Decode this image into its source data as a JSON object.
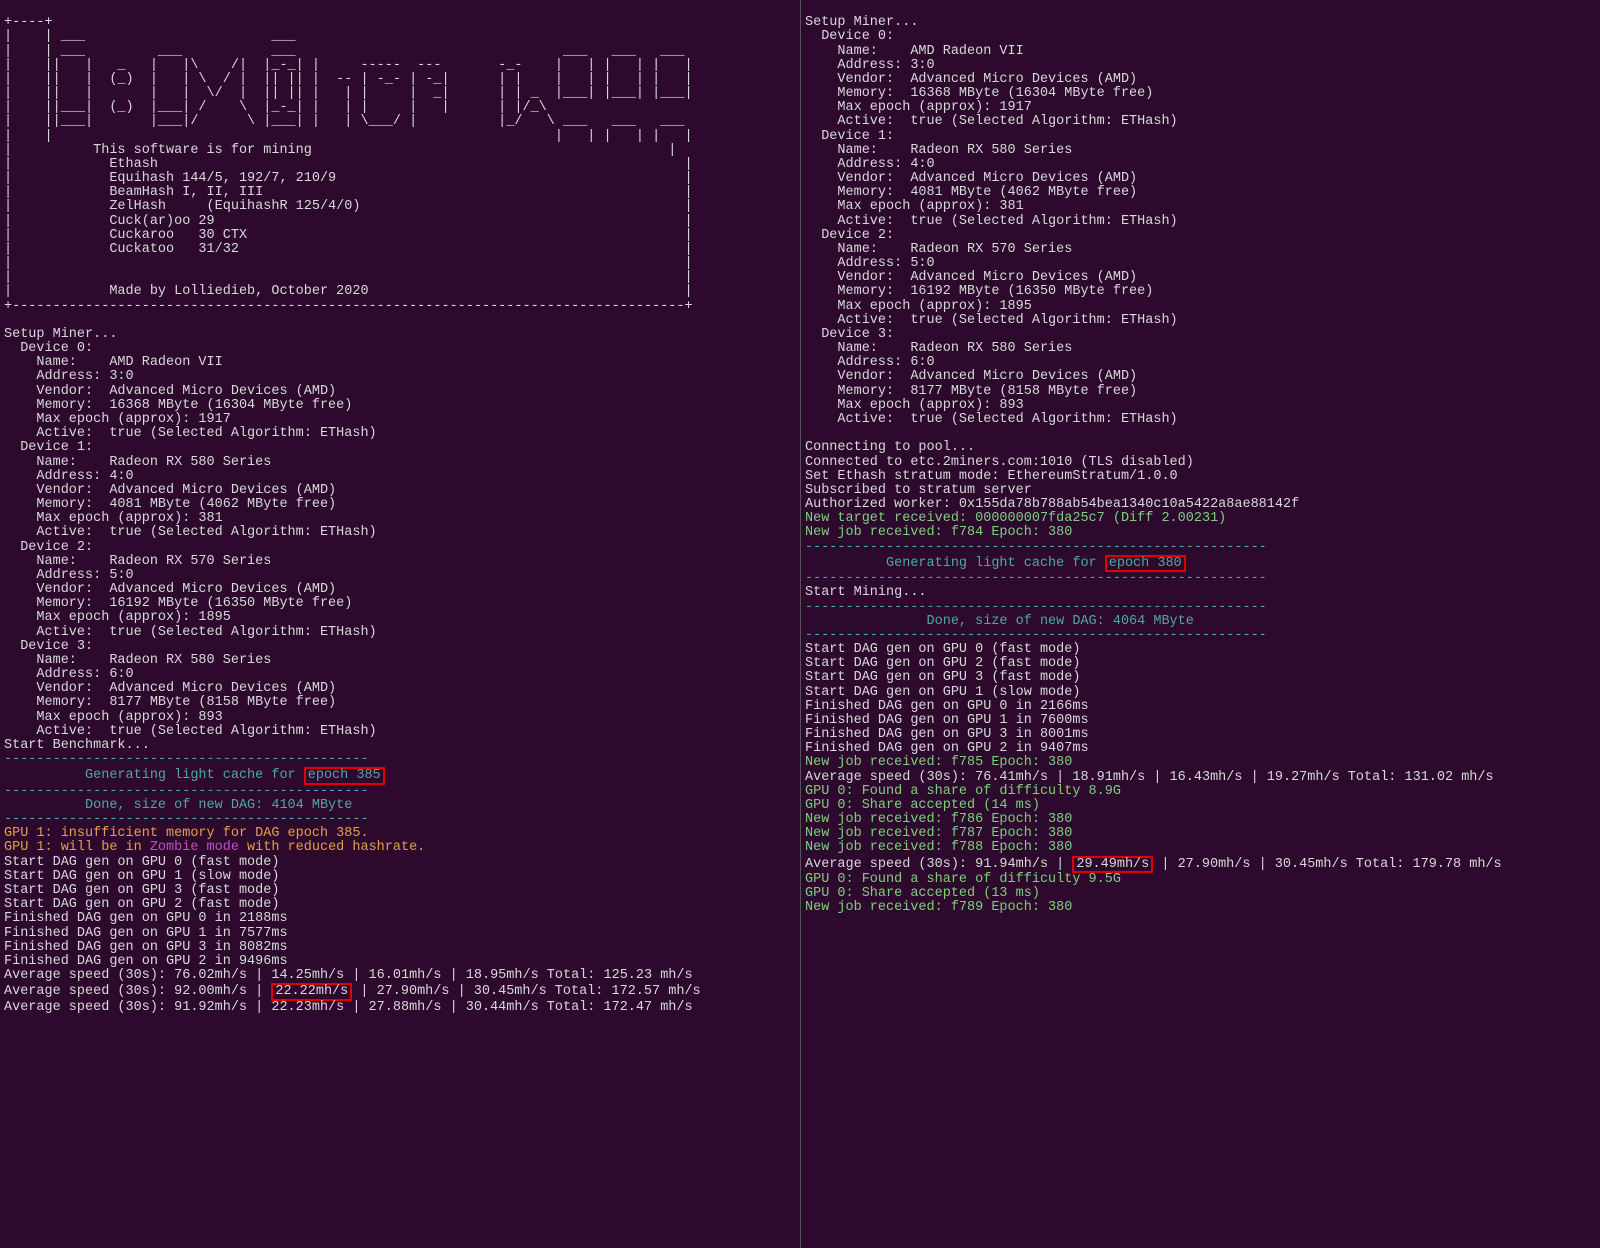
{
  "ascii_art": {
    "l1": "+----+",
    "l2": "|    | ___                       ___",
    "l3": "|    | ___         ___           ___                                 ___   ___   ___",
    "l4": "|    ||   |   _   |   |\\    /|  |_-_| |     -----  ---       -_-    |   | |   | |   |",
    "l5": "|    ||   |  (_)  |   | \\  / |  || || |  -- | -_- | -_|      | |    |   | |   | |   |",
    "l6": "|    ||   |       |   |  \\/  |  || || |   | |     |  _|      | | _  |___| |___| |___|",
    "l7": "|    ||___|  (_)  |___| /    \\  |_-_| |   | |     |   |      | |/_\\",
    "l8": "|    ||___|       |___|/      \\ |___| |   | \\___/ |          |_/   \\ ___   ___   ___",
    "l9": "|    |                                                              |   | |   | |   |",
    "l10": "|          This software is for mining                                            |",
    "l11": "|            Ethash                                                                 |",
    "l12": "|            Equihash 144/5, 192/7, 210/9                                           |",
    "l13": "|            BeamHash I, II, III                                                    |",
    "l14": "|            ZelHash     (EquihashR 125/4/0)                                        |",
    "l15": "|            Cuck(ar)oo 29                                                          |",
    "l16": "|            Cuckaroo   30 CTX                                                      |",
    "l17": "|            Cuckatoo   31/32                                                       |",
    "l18": "|                                                                                   |",
    "l19": "|                                                                                   |",
    "l20": "|            Made by Lolliedieb, October 2020                                       |",
    "l21": "+-----------------------------------------------------------------------------------+"
  },
  "setup": {
    "title": "Setup Miner...",
    "dev0": {
      "hdr": "  Device 0:",
      "name": "    Name:    AMD Radeon VII",
      "addr": "    Address: 3:0",
      "vendor": "    Vendor:  Advanced Micro Devices (AMD)",
      "mem": "    Memory:  16368 MByte (16304 MByte free)",
      "maxep": "    Max epoch (approx): 1917",
      "active": "    Active:  true (Selected Algorithm: ETHash)"
    },
    "dev1": {
      "hdr": "  Device 1:",
      "name": "    Name:    Radeon RX 580 Series",
      "addr": "    Address: 4:0",
      "vendor": "    Vendor:  Advanced Micro Devices (AMD)",
      "mem": "    Memory:  4081 MByte (4062 MByte free)",
      "maxep": "    Max epoch (approx): 381",
      "active": "    Active:  true (Selected Algorithm: ETHash)"
    },
    "dev2": {
      "hdr": "  Device 2:",
      "name": "    Name:    Radeon RX 570 Series",
      "addr": "    Address: 5:0",
      "vendor": "    Vendor:  Advanced Micro Devices (AMD)",
      "mem": "    Memory:  16192 MByte (16350 MByte free)",
      "maxep": "    Max epoch (approx): 1895",
      "active": "    Active:  true (Selected Algorithm: ETHash)"
    },
    "dev3": {
      "hdr": "  Device 3:",
      "name": "    Name:    Radeon RX 580 Series",
      "addr": "    Address: 6:0",
      "vendor": "    Vendor:  Advanced Micro Devices (AMD)",
      "mem": "    Memory:  8177 MByte (8158 MByte free)",
      "maxep": "    Max epoch (approx): 893",
      "active": "    Active:  true (Selected Algorithm: ETHash)"
    }
  },
  "left": {
    "start_bench": "Start Benchmark...",
    "dashes1": "---------------------------------------------",
    "gen_cache_pre": "          Generating light cache for ",
    "epoch_box": "epoch 385",
    "dashes2": "---------------------------------------------",
    "done_dag": "          Done, size of new DAG: 4104 MByte",
    "dashes3": "---------------------------------------------",
    "warn1": "GPU 1: insufficient memory for DAG epoch 385.",
    "warn2a": "GPU 1: will be in ",
    "warn2_zombie": "Zombie mode",
    "warn2b": " with reduced hashrate.",
    "dag0": "Start DAG gen on GPU 0 (fast mode)",
    "dag1": "Start DAG gen on GPU 1 (slow mode)",
    "dag2": "Start DAG gen on GPU 3 (fast mode)",
    "dag3": "Start DAG gen on GPU 2 (fast mode)",
    "fin0": "Finished DAG gen on GPU 0 in 2188ms",
    "fin1": "Finished DAG gen on GPU 1 in 7577ms",
    "fin2": "Finished DAG gen on GPU 3 in 8082ms",
    "fin3": "Finished DAG gen on GPU 2 in 9496ms",
    "avg1": "Average speed (30s): 76.02mh/s | 14.25mh/s | 16.01mh/s | 18.95mh/s Total: 125.23 mh/s",
    "avg2_pre": "Average speed (30s): 92.00mh/s | ",
    "avg2_box": "22.22mh/s",
    "avg2_post": " | 27.90mh/s | 30.45mh/s Total: 172.57 mh/s",
    "avg3": "Average speed (30s): 91.92mh/s | 22.23mh/s | 27.88mh/s | 30.44mh/s Total: 172.47 mh/s"
  },
  "right": {
    "conn1": "Connecting to pool...",
    "conn2": "Connected to etc.2miners.com:1010 (TLS disabled)",
    "conn3": "Set Ethash stratum mode: EthereumStratum/1.0.0",
    "conn4": "Subscribed to stratum server",
    "conn5": "Authorized worker: 0x155da78b788ab54bea1340c10a5422a8ae88142f",
    "target": "New target received: 000000007fda25c7 (Diff 2.00231)",
    "job1": "New job received: f784 Epoch: 380",
    "gen_cache_pre": "          Generating light cache for ",
    "epoch_box": "epoch 380",
    "dashes1": "---------------------------------------------------------",
    "start_mine": "Start Mining...",
    "dashes2": "---------------------------------------------------------",
    "done_dag": "               Done, size of new DAG: 4064 MByte",
    "dashes3": "---------------------------------------------------------",
    "dag0": "Start DAG gen on GPU 0 (fast mode)",
    "dag1": "Start DAG gen on GPU 2 (fast mode)",
    "dag2": "Start DAG gen on GPU 3 (fast mode)",
    "dag3": "Start DAG gen on GPU 1 (slow mode)",
    "fin0": "Finished DAG gen on GPU 0 in 2166ms",
    "fin1": "Finished DAG gen on GPU 1 in 7600ms",
    "fin2": "Finished DAG gen on GPU 3 in 8001ms",
    "fin3": "Finished DAG gen on GPU 2 in 9407ms",
    "job2": "New job received: f785 Epoch: 380",
    "avg1": "Average speed (30s): 76.41mh/s | 18.91mh/s | 16.43mh/s | 19.27mh/s Total: 131.02 mh/s",
    "share1": "GPU 0: Found a share of difficulty 8.9G",
    "share2": "GPU 0: Share accepted (14 ms)",
    "job3": "New job received: f786 Epoch: 380",
    "job4": "New job received: f787 Epoch: 380",
    "job5": "New job received: f788 Epoch: 380",
    "avg2_pre": "Average speed (30s): 91.94mh/s | ",
    "avg2_box": "29.49mh/s",
    "avg2_post": " | 27.90mh/s | 30.45mh/s Total: 179.78 mh/s",
    "share3": "GPU 0: Found a share of difficulty 9.5G",
    "share4": "GPU 0: Share accepted (13 ms)",
    "job6": "New job received: f789 Epoch: 380"
  }
}
